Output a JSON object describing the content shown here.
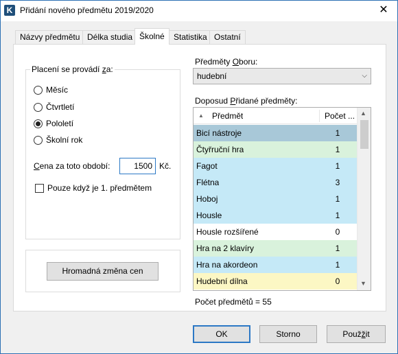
{
  "window": {
    "title": "Přidání nového předmětu 2019/2020",
    "app_icon_letter": "K",
    "close_glyph": "✕"
  },
  "tabs": [
    {
      "label": "Názvy předmětu",
      "active": false
    },
    {
      "label": "Délka studia",
      "active": false
    },
    {
      "label": "Školné",
      "active": true
    },
    {
      "label": "Statistika",
      "active": false
    },
    {
      "label": "Ostatní",
      "active": false
    }
  ],
  "payment_group": {
    "legend_prefix": "Placení se provádí ",
    "legend_ul": "z",
    "legend_suffix": "a:",
    "options": [
      {
        "label": "Měsíc",
        "checked": false
      },
      {
        "label": "Čtvrtletí",
        "checked": false
      },
      {
        "label": "Pololetí",
        "checked": true
      },
      {
        "label": "Školní rok",
        "checked": false
      }
    ],
    "price_label_ul": "C",
    "price_label_rest": "ena za toto období:",
    "price_value": "1500",
    "currency": "Kč.",
    "only_first_label": "Pouze když je 1. předmětem",
    "only_first_checked": false
  },
  "bulk_button_label": "Hromadná změna cen",
  "field": {
    "label_prefix": "Předměty ",
    "label_ul": "O",
    "label_suffix": "boru:",
    "selected": "hudební"
  },
  "added": {
    "label_prefix": "Doposud ",
    "label_ul": "P",
    "label_suffix": "řidané předměty:",
    "col_subject": "Předmět",
    "col_count": "Počet ...",
    "sort_glyph": "▲",
    "rows": [
      {
        "name": "Bicí nástroje",
        "count": "1",
        "color": "#a8c8d8"
      },
      {
        "name": "Čtyřruční hra",
        "count": "1",
        "color": "#d9f2dc"
      },
      {
        "name": "Fagot",
        "count": "1",
        "color": "#c5e9f7"
      },
      {
        "name": "Flétna",
        "count": "3",
        "color": "#c5e9f7"
      },
      {
        "name": "Hoboj",
        "count": "1",
        "color": "#c5e9f7"
      },
      {
        "name": "Housle",
        "count": "1",
        "color": "#c5e9f7"
      },
      {
        "name": "Housle rozšířené",
        "count": "0",
        "color": "#ffffff"
      },
      {
        "name": "Hra na 2 klavíry",
        "count": "1",
        "color": "#d9f2dc"
      },
      {
        "name": "Hra na akordeon",
        "count": "1",
        "color": "#c5e9f7"
      },
      {
        "name": "Hudební dílna",
        "count": "0",
        "color": "#fcf7c4"
      }
    ],
    "total_label": "Počet předmětů = 55"
  },
  "buttons": {
    "ok": "OK",
    "cancel": "Storno",
    "apply_ul": "ž",
    "apply_prefix": "Použ",
    "apply_suffix": "it"
  }
}
